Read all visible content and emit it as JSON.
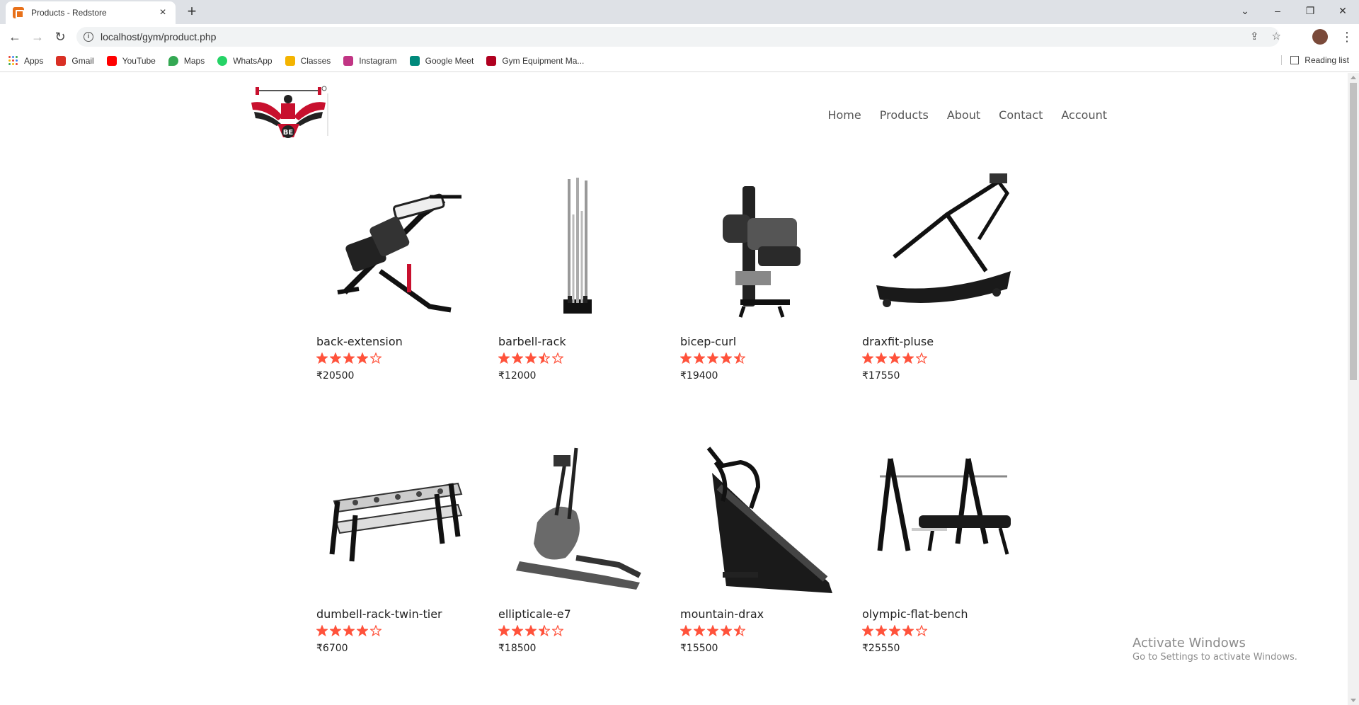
{
  "browser": {
    "tab_title": "Products - Redstore",
    "url": "localhost/gym/product.php",
    "bookmarks": [
      {
        "label": "Apps",
        "icon": "apps-grid-icon"
      },
      {
        "label": "Gmail",
        "icon": "gmail-icon",
        "color": "#d93025"
      },
      {
        "label": "YouTube",
        "icon": "youtube-icon",
        "color": "#ff0000"
      },
      {
        "label": "Maps",
        "icon": "maps-pin-icon",
        "color": "#34a853"
      },
      {
        "label": "WhatsApp",
        "icon": "whatsapp-icon",
        "color": "#25d366"
      },
      {
        "label": "Classes",
        "icon": "classroom-icon",
        "color": "#f4b400"
      },
      {
        "label": "Instagram",
        "icon": "instagram-icon",
        "color": "#c13584"
      },
      {
        "label": "Google Meet",
        "icon": "meet-icon",
        "color": "#00897b"
      },
      {
        "label": "Gym Equipment Ma...",
        "icon": "gym-equipment-icon",
        "color": "#b00020"
      }
    ],
    "reading_list": "Reading list"
  },
  "nav": {
    "home": "Home",
    "products": "Products",
    "about": "About",
    "contact": "Contact",
    "account": "Account"
  },
  "products": [
    {
      "name": "back-extension",
      "price": "₹20500",
      "rating": 4
    },
    {
      "name": "barbell-rack",
      "price": "₹12000",
      "rating": 3.5
    },
    {
      "name": "bicep-curl",
      "price": "₹19400",
      "rating": 4.5
    },
    {
      "name": "draxfit-pluse",
      "price": "₹17550",
      "rating": 4
    },
    {
      "name": "dumbell-rack-twin-tier",
      "price": "₹6700",
      "rating": 4
    },
    {
      "name": "ellipticale-e7",
      "price": "₹18500",
      "rating": 3.5
    },
    {
      "name": "mountain-drax",
      "price": "₹15500",
      "rating": 4.5
    },
    {
      "name": "olympic-flat-bench",
      "price": "₹25550",
      "rating": 4
    }
  ],
  "watermark": {
    "line1": "Activate Windows",
    "line2": "Go to Settings to activate Windows."
  },
  "colors": {
    "star": "#ff523b",
    "logo_red": "#c8102e"
  }
}
